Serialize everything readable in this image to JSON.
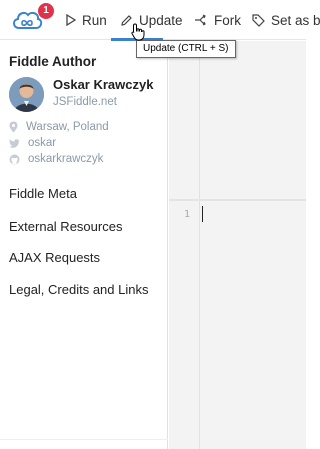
{
  "toolbar": {
    "notification_count": "1",
    "run_label": "Run",
    "update_label": "Update",
    "fork_label": "Fork",
    "set_label": "Set as b",
    "tooltip": "Update (CTRL + S)"
  },
  "sidebar": {
    "author_section_title": "Fiddle Author",
    "author": {
      "name": "Oskar Krawczyk",
      "site": "JSFiddle.net",
      "location": "Warsaw, Poland",
      "twitter": "oskar",
      "github": "oskarkrawczyk"
    },
    "menu": [
      {
        "label": "Fiddle Meta"
      },
      {
        "label": "External Resources"
      },
      {
        "label": "AJAX Requests"
      },
      {
        "label": "Legal, Credits and Links"
      }
    ]
  },
  "editor": {
    "line_number": "1"
  },
  "colors": {
    "accent": "#3a83cc",
    "badge": "#e0324b",
    "muted_text": "#8a9aa8",
    "editor_bg": "#f3f3f3"
  },
  "icons": [
    "jsfiddle-logo-icon",
    "play-icon",
    "pencil-icon",
    "fork-icon",
    "tag-icon",
    "pointer-cursor-icon",
    "location-pin-icon",
    "twitter-icon",
    "github-icon"
  ]
}
